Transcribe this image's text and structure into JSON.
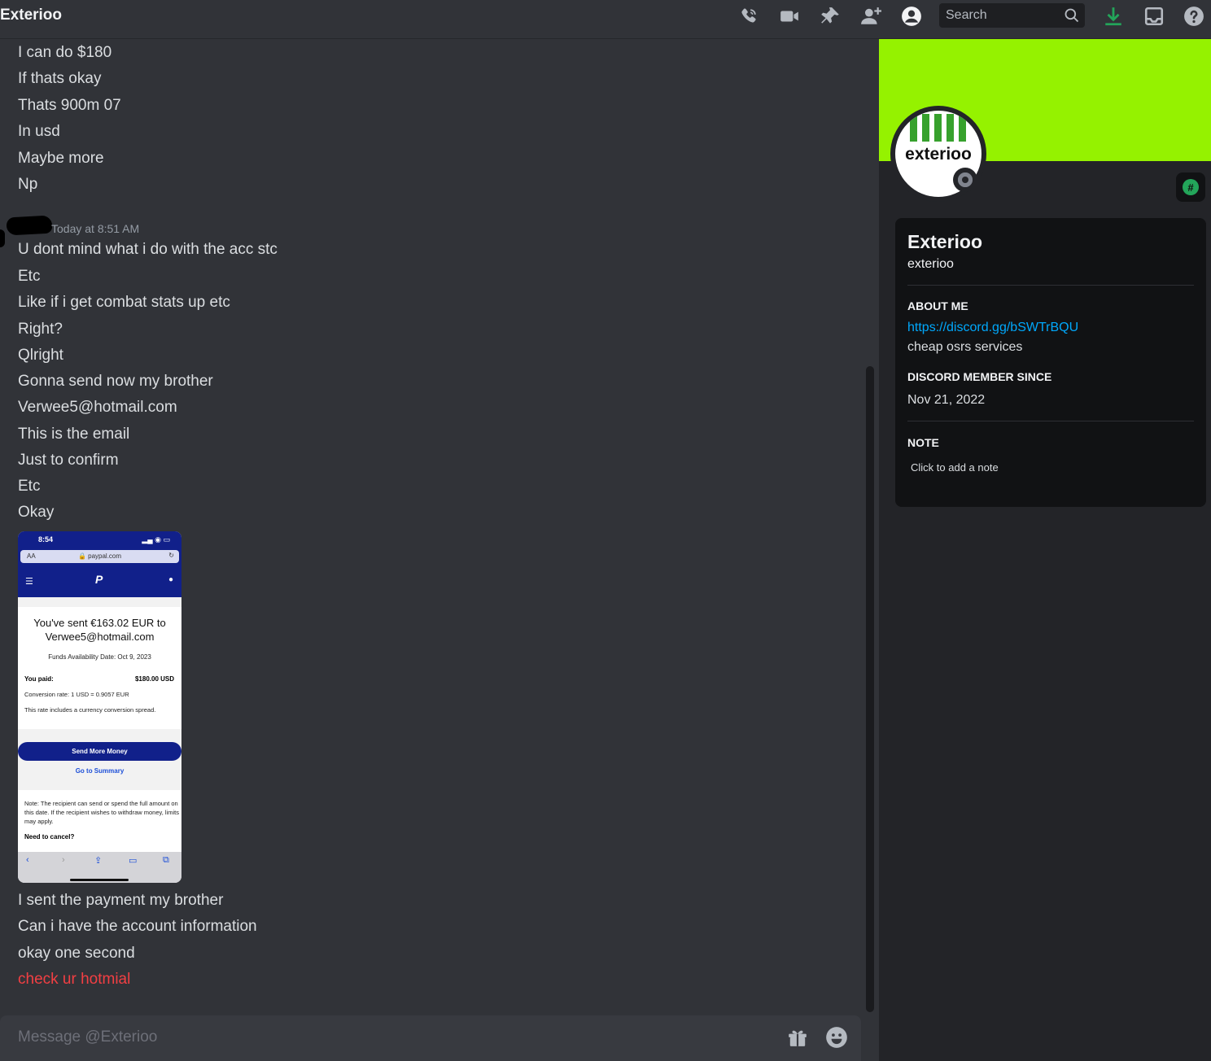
{
  "app": {
    "title": "Exterioo"
  },
  "toolbar": {
    "icons": [
      "phone-call-icon",
      "video-camera-icon",
      "pin-icon",
      "add-friend-icon",
      "user-profile-icon",
      "download-icon",
      "inbox-icon",
      "help-icon"
    ],
    "search_placeholder": "Search"
  },
  "chat": {
    "messages_top": [
      "I can do $180",
      "If thats okay",
      "Thats 900m 07",
      "In usd",
      "Maybe more",
      "Np"
    ],
    "group": {
      "timestamp": "Today at 8:51 AM",
      "messages": [
        "U dont mind what i do with the acc stc",
        "Etc",
        "Like if i get combat stats up etc",
        "Right?",
        "Qlright",
        "Gonna send now my brother",
        "Verwee5@hotmail.com",
        "This is the email",
        "Just to confirm",
        "Etc",
        "Okay"
      ]
    },
    "attachment": {
      "status_time": "8:54",
      "url_prefix": "AA",
      "url": "🔒 paypal.com",
      "heading": "You've sent €163.02 EUR to Verwee5@hotmail.com",
      "funds_date": "Funds Availability Date: Oct 9, 2023",
      "paid_label": "You paid:",
      "paid_value": "$180.00 USD",
      "conversion": "Conversion rate: 1 USD = 0.9057 EUR",
      "rate_note": "This rate includes a currency conversion spread.",
      "send_more_button": "Send More Money",
      "summary_link": "Go to Summary",
      "note": "Note: The recipient can send or spend the full amount on this date. If the recipient wishes to withdraw money, limits may apply.",
      "cancel_heading": "Need to cancel?"
    },
    "messages_after": [
      "I sent the payment my brother",
      "Can i have the account information",
      "okay one second"
    ],
    "red_message": "check ur hotmial",
    "composer_placeholder": "Message @Exterioo"
  },
  "profile": {
    "avatar_text": "exterioo",
    "banner_color": "#95f200",
    "display_name": "Exterioo",
    "username": "exterioo",
    "about_heading": "ABOUT ME",
    "about_link": "https://discord.gg/bSWTrBQU",
    "about_text": "cheap osrs services",
    "member_heading": "DISCORD MEMBER SINCE",
    "member_date": "Nov 21, 2022",
    "note_heading": "NOTE",
    "note_placeholder": "Click to add a note",
    "badge_symbol": "#"
  }
}
